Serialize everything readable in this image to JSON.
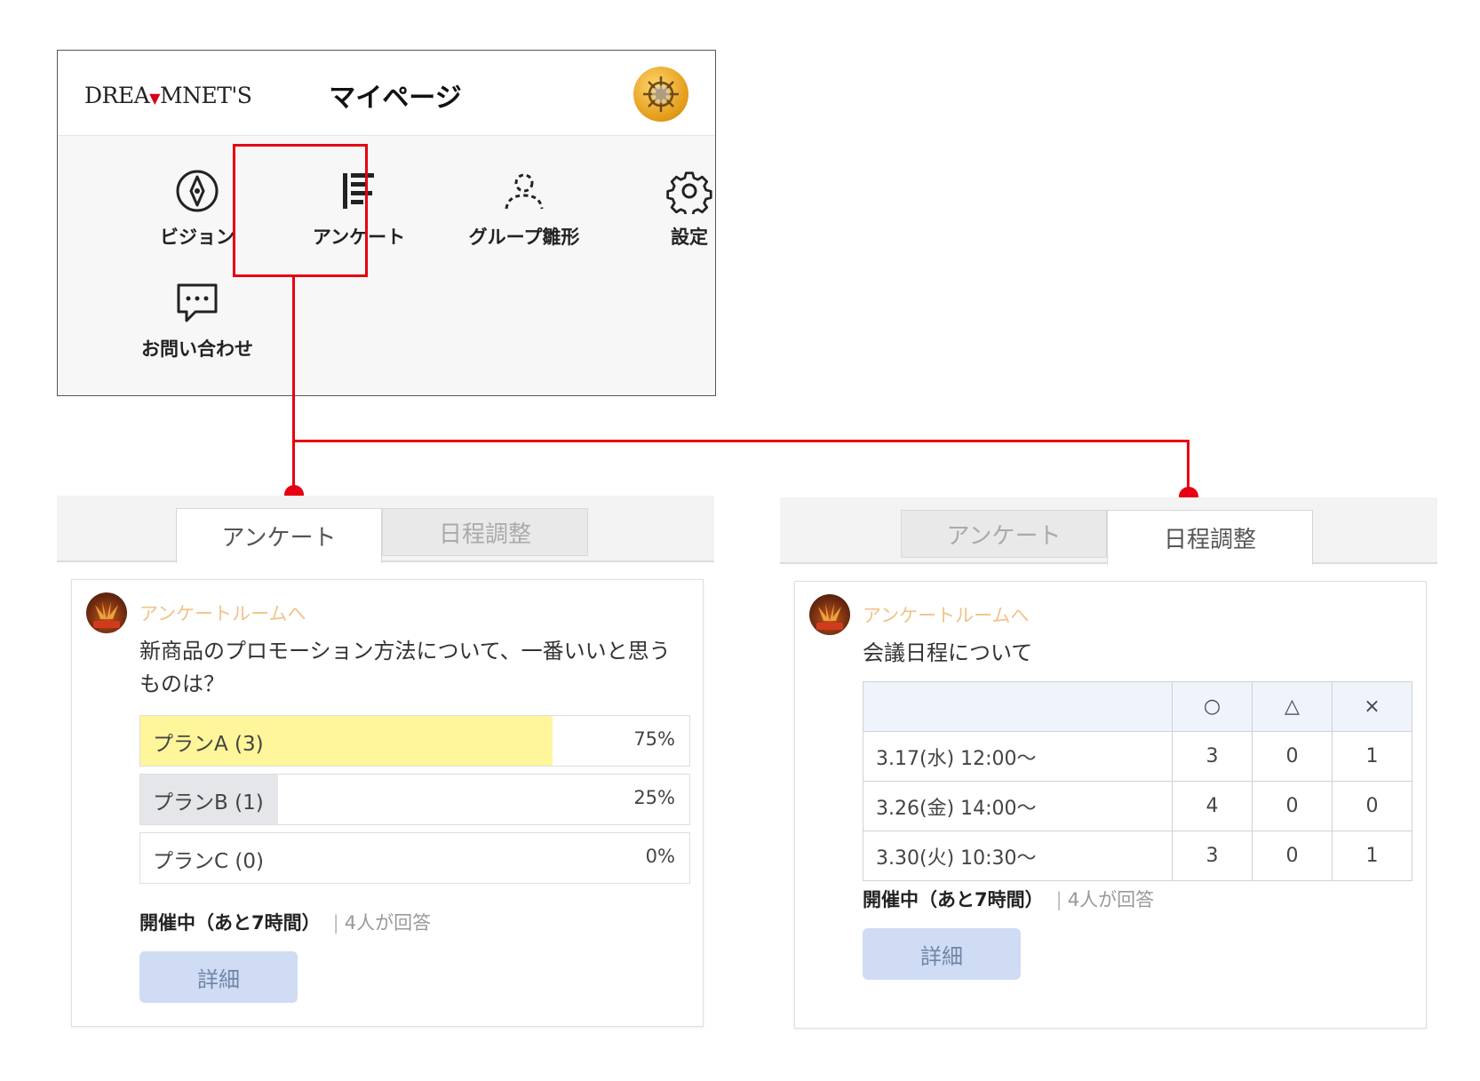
{
  "mypage": {
    "logo": {
      "pre": "DREA",
      "mid": "M",
      "post": "NET'S"
    },
    "title": "マイページ",
    "menu": [
      {
        "label": "ビジョン",
        "icon": "compass-icon"
      },
      {
        "label": "アンケート",
        "icon": "survey-bars-icon"
      },
      {
        "label": "グループ雛形",
        "icon": "group-template-icon"
      },
      {
        "label": "設定",
        "icon": "gear-icon"
      },
      {
        "label": "お問い合わせ",
        "icon": "chat-bubble-icon"
      }
    ]
  },
  "left": {
    "tabs": [
      "アンケート",
      "日程調整"
    ],
    "room_link": "アンケートルームへ",
    "question": "新商品のプロモーション方法について、一番いいと思うものは？",
    "options": [
      {
        "label": "プランA (3)",
        "percent": "75%",
        "share": 0.75,
        "color": "#fff59a"
      },
      {
        "label": "プランB (1)",
        "percent": "25%",
        "share": 0.25,
        "color": "#e4e6ea"
      },
      {
        "label": "プランC (0)",
        "percent": "0%",
        "share": 0.0,
        "color": "#ffffff"
      }
    ],
    "status_bold": "開催中（あと7時間）",
    "status_sep": "|",
    "status_count": "4人が回答",
    "detail": "詳細"
  },
  "right": {
    "tabs": [
      "アンケート",
      "日程調整"
    ],
    "room_link": "アンケートルームへ",
    "question": "会議日程について",
    "marks": [
      "○",
      "△",
      "×"
    ],
    "rows": [
      {
        "date": "3.17(水) 12:00～",
        "v": [
          "3",
          "0",
          "1"
        ]
      },
      {
        "date": "3.26(金) 14:00～",
        "v": [
          "4",
          "0",
          "0"
        ]
      },
      {
        "date": "3.30(火) 10:30～",
        "v": [
          "3",
          "0",
          "1"
        ]
      }
    ],
    "status_bold": "開催中（あと7時間）",
    "status_sep": "|",
    "status_count": "4人が回答",
    "detail": "詳細"
  },
  "colors": {
    "accent_red": "#e60012",
    "link_orange": "#f2c289",
    "button_blue": "#cfdcf3"
  }
}
